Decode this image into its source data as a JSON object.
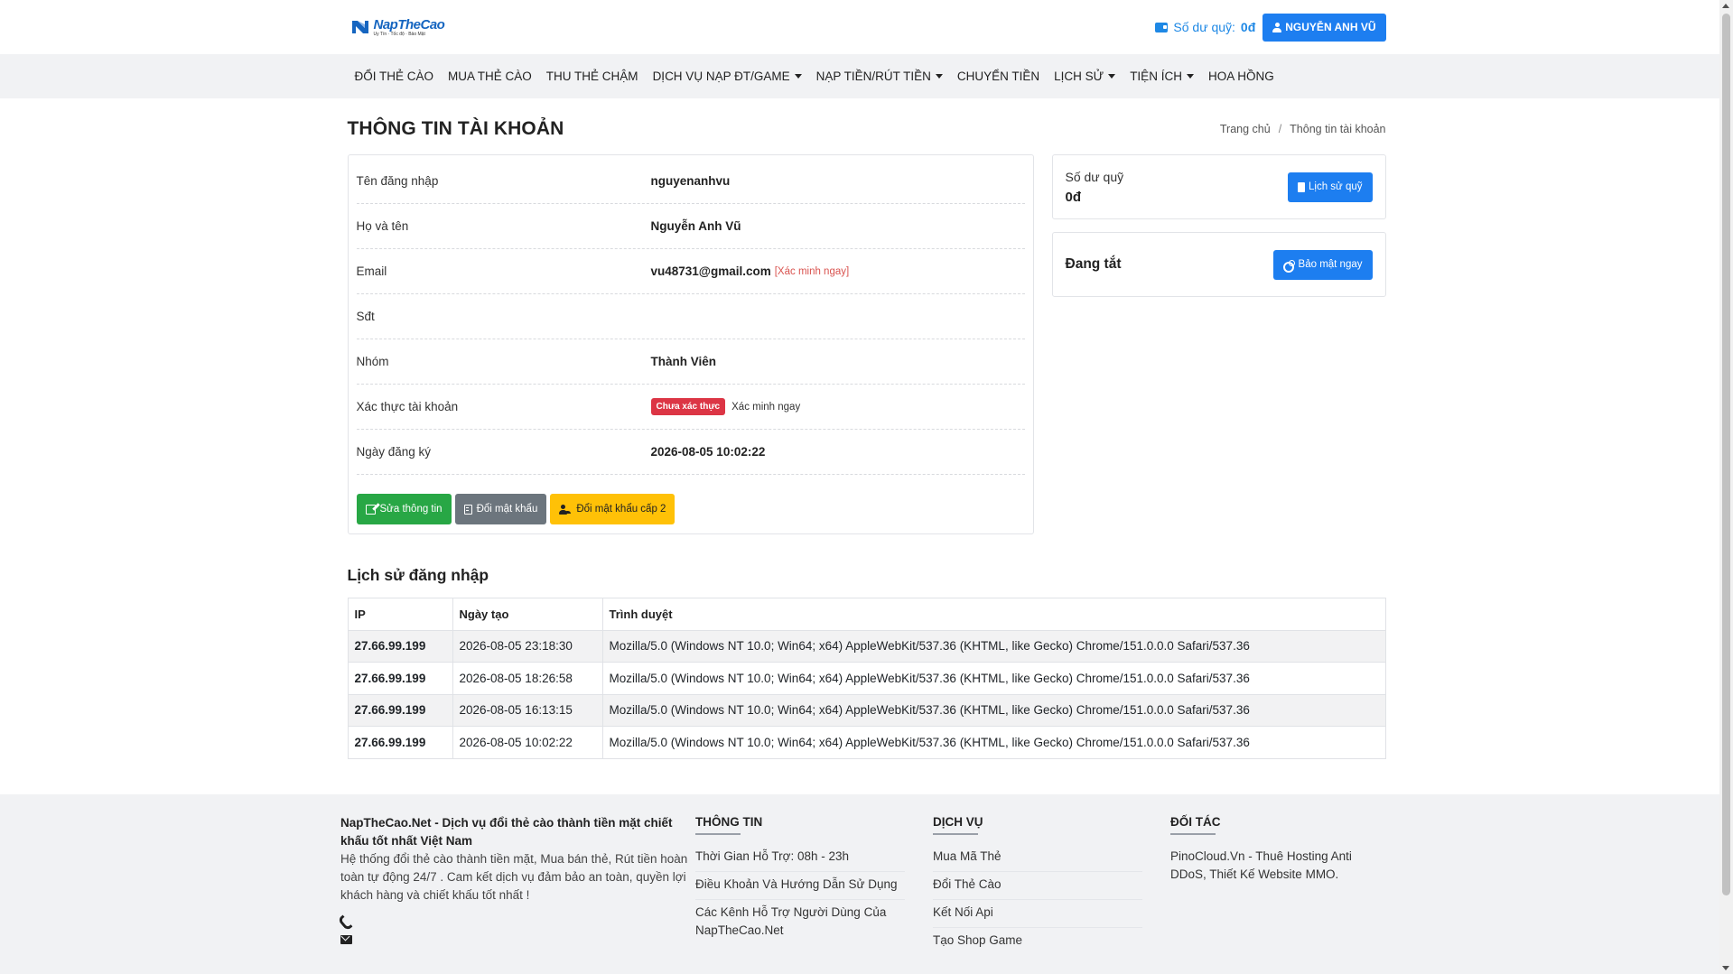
{
  "header": {
    "logo_name": "NapTheCao",
    "logo_sub": "Uy Tín · Tốc độ · Bảo Mật",
    "balance_label": "Số dư quỹ:",
    "balance_value": "0đ",
    "user_name": "NGUYỄN ANH VŨ"
  },
  "nav": {
    "items": [
      {
        "label": "ĐỔI THẺ CÀO"
      },
      {
        "label": "MUA THẺ CÀO"
      },
      {
        "label": "THU THẺ CHẬM"
      },
      {
        "label": "DỊCH VỤ NẠP ĐT/GAME"
      },
      {
        "label": "NẠP TIỀN/RÚT TIỀN"
      },
      {
        "label": "CHUYỂN TIỀN"
      },
      {
        "label": "LỊCH SỬ"
      },
      {
        "label": "TIỆN ÍCH"
      },
      {
        "label": "HOA HỒNG"
      }
    ]
  },
  "page": {
    "title": "THÔNG TIN TÀI KHOẢN",
    "breadcrumb_home": "Trang chủ",
    "breadcrumb_sep": "/",
    "breadcrumb_current": "Thông tin tài khoản"
  },
  "account": {
    "username_label": "Tên đăng nhập",
    "username": "nguyenanhvu",
    "fullname_label": "Họ và tên",
    "fullname": "Nguyễn Anh Vũ",
    "email_label": "Email",
    "email": "vu48731@gmail.com",
    "email_verify": "[Xác minh ngay]",
    "phone_label": "Sđt",
    "phone": "",
    "group_label": "Nhóm",
    "group": "Thành Viên",
    "verify_label": "Xác thực tài khoản",
    "verify_badge": "Chưa xác thực",
    "verify_action": "Xác minh ngay",
    "reg_label": "Ngày đăng ký",
    "reg_date": "2026-08-05 10:02:22",
    "btn_edit": "Sửa thông tin",
    "btn_password": "Đổi mật khẩu",
    "btn_password2": "Đổi mật khẩu cấp 2"
  },
  "side": {
    "fund_label": "Số dư quỹ",
    "fund_value": "0đ",
    "fund_history_btn": "Lịch sử quỹ",
    "security_status": "Đang tắt",
    "security_btn": "Bảo mật ngay"
  },
  "history": {
    "title": "Lịch sử đăng nhập",
    "headers": {
      "ip": "IP",
      "date": "Ngày tạo",
      "browser": "Trình duyệt"
    },
    "rows": [
      {
        "ip": "27.66.99.199",
        "date": "2026-08-05 23:18:30",
        "browser": "Mozilla/5.0 (Windows NT 10.0; Win64; x64) AppleWebKit/537.36 (KHTML, like Gecko) Chrome/151.0.0.0 Safari/537.36"
      },
      {
        "ip": "27.66.99.199",
        "date": "2026-08-05 18:26:58",
        "browser": "Mozilla/5.0 (Windows NT 10.0; Win64; x64) AppleWebKit/537.36 (KHTML, like Gecko) Chrome/151.0.0.0 Safari/537.36"
      },
      {
        "ip": "27.66.99.199",
        "date": "2026-08-05 16:13:15",
        "browser": "Mozilla/5.0 (Windows NT 10.0; Win64; x64) AppleWebKit/537.36 (KHTML, like Gecko) Chrome/151.0.0.0 Safari/537.36"
      },
      {
        "ip": "27.66.99.199",
        "date": "2026-08-05 10:02:22",
        "browser": "Mozilla/5.0 (Windows NT 10.0; Win64; x64) AppleWebKit/537.36 (KHTML, like Gecko) Chrome/151.0.0.0 Safari/537.36"
      }
    ]
  },
  "footer": {
    "brand": "NapTheCao.Net - Dịch vụ đổi thẻ cào thành tiền mặt chiết khấu tốt nhất Việt Nam",
    "desc": "Hệ thống đổi thẻ cào thành tiền mặt, Mua bán thẻ, Rút tiền hoàn toàn tự động 24/7 . Cam kết dịch vụ đảm bảo an toàn, quyền lợi khách hàng và chiết khấu tốt nhất !",
    "info_title": "THÔNG TIN",
    "info_links": [
      {
        "label": "Thời Gian Hỗ Trợ: 08h - 23h"
      },
      {
        "label": "Điều Khoản Và Hướng Dẫn Sử Dụng"
      },
      {
        "label": "Các Kênh Hỗ Trợ Người Dùng Của NapTheCao.Net"
      }
    ],
    "service_title": "DỊCH VỤ",
    "service_links": [
      {
        "label": "Mua Mã Thẻ"
      },
      {
        "label": "Đổi Thẻ Cào"
      },
      {
        "label": "Kết Nối Api"
      },
      {
        "label": "Tạo Shop Game"
      }
    ],
    "partner_title": "ĐỐI TÁC",
    "partner_text": "PinoCloud.Vn - Thuê Hosting Anti DDoS, Thiết Kế Website MMO."
  },
  "colors": {
    "primary": "#1d7ef0",
    "success": "#28a745",
    "secondary": "#6c757d",
    "warning": "#ffc107",
    "danger": "#dc3545"
  }
}
